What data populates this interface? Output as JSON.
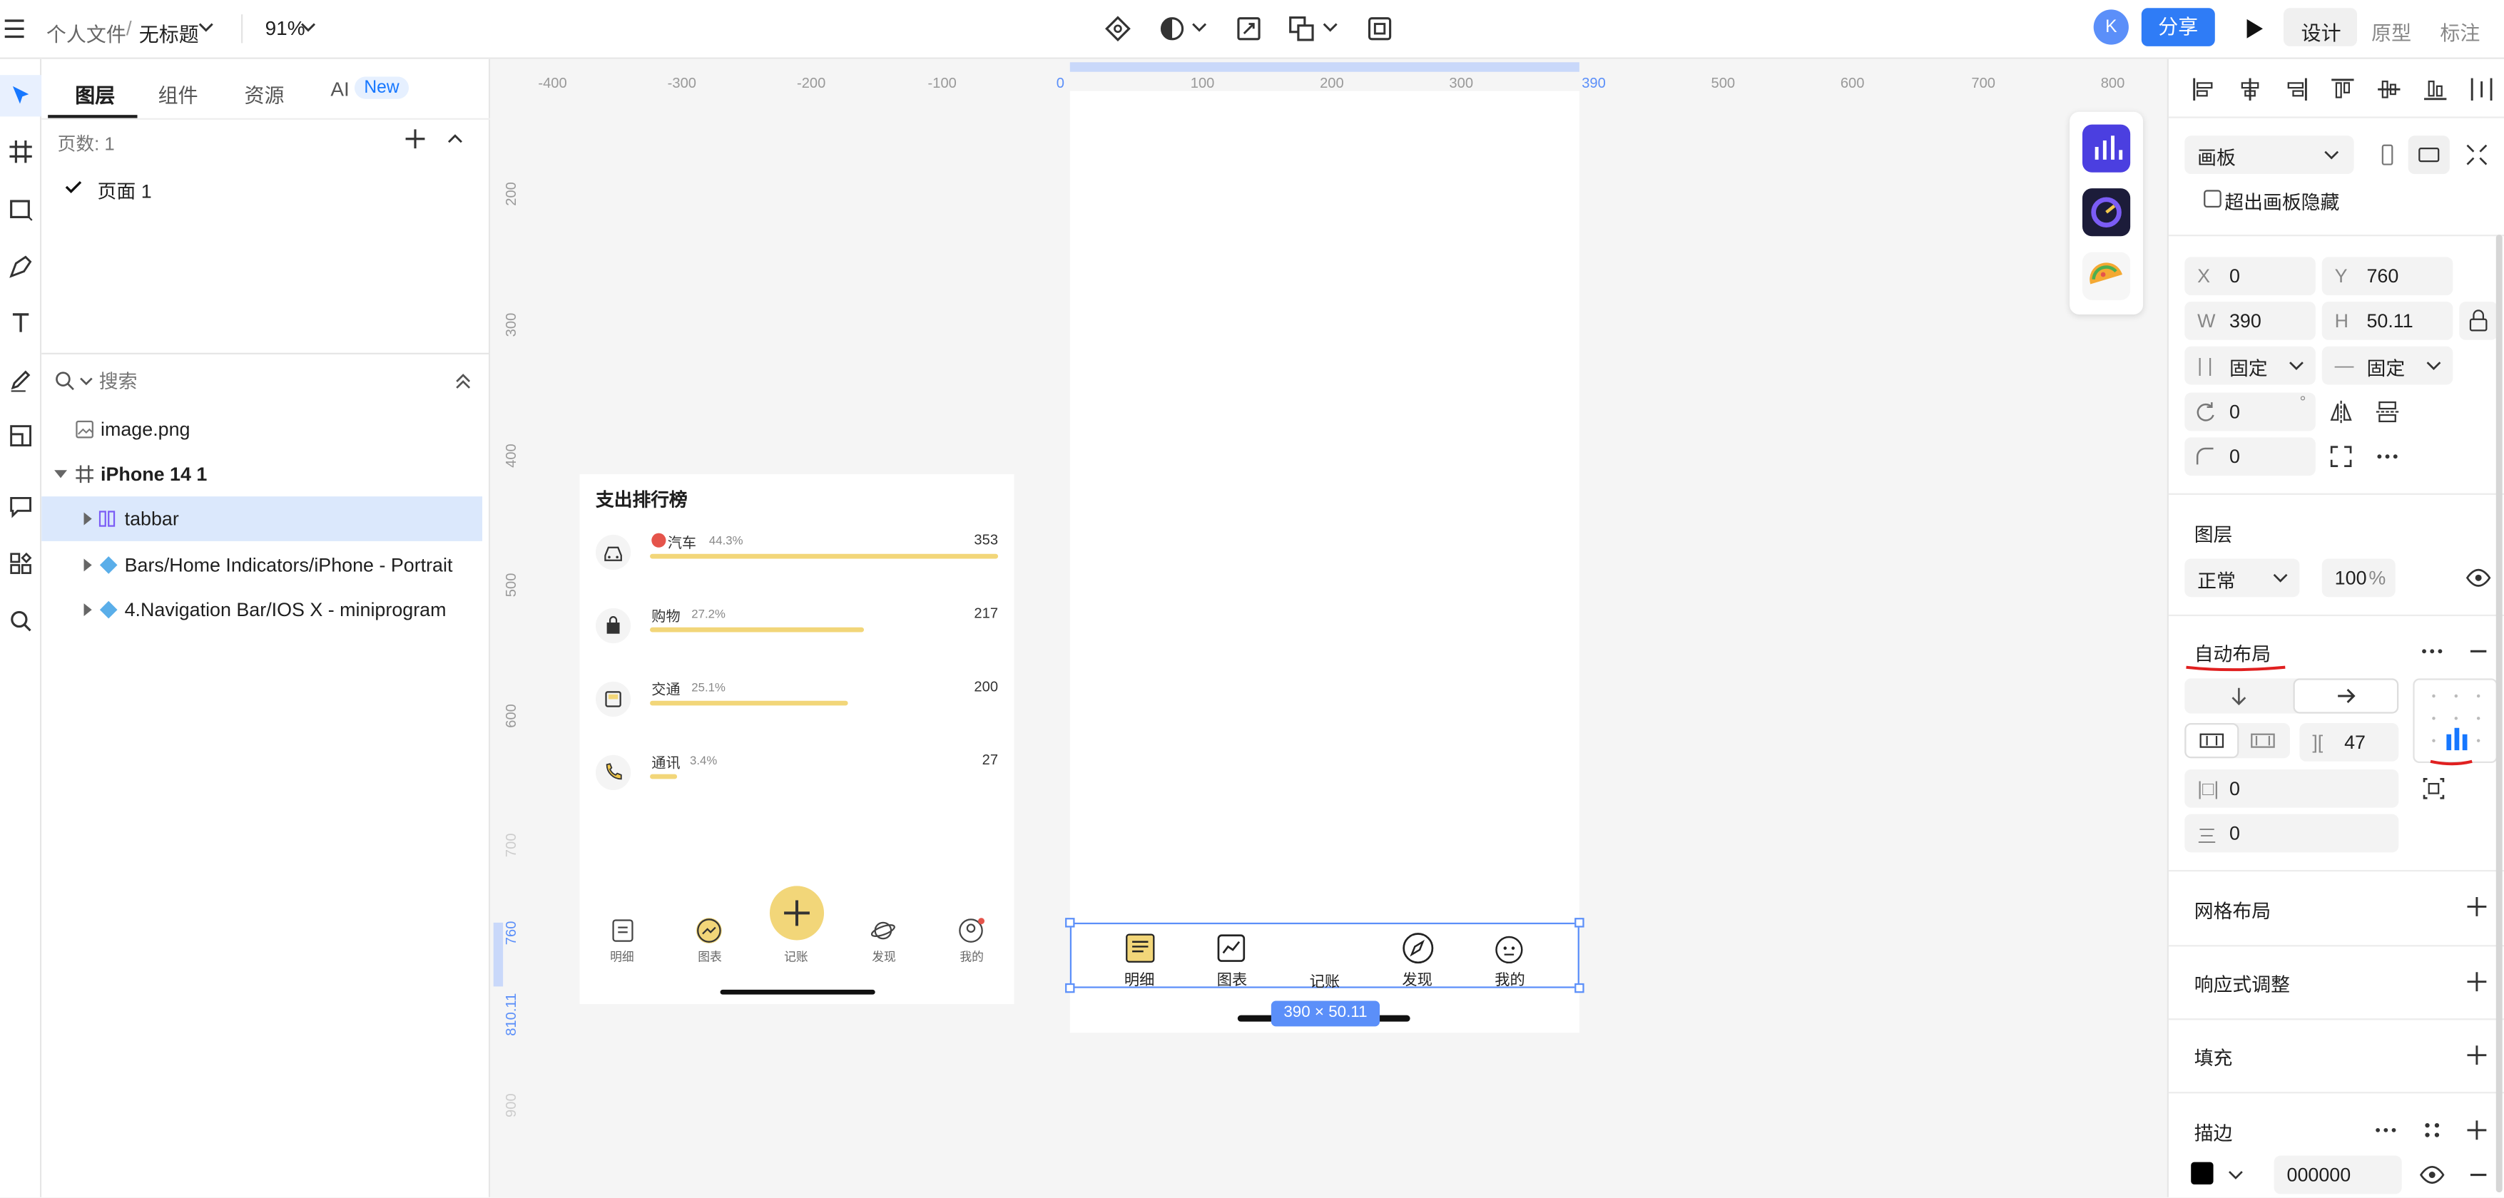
{
  "topbar": {
    "breadcrumb_parent": "个人文件",
    "breadcrumb_sep": "/",
    "file_name": "无标题",
    "zoom": "91%",
    "avatar_letter": "K",
    "share_label": "分享",
    "mode_tabs": [
      "设计",
      "原型",
      "标注"
    ]
  },
  "layers_panel": {
    "tabs": [
      "图层",
      "组件",
      "资源",
      "AI"
    ],
    "ai_badge": "New",
    "page_count_label": "页数: 1",
    "pages": [
      "页面 1"
    ],
    "search_placeholder": "搜索",
    "layers": [
      {
        "name": "image.png",
        "depth": 0
      },
      {
        "name": "iPhone 14 1",
        "depth": 0
      },
      {
        "name": "tabbar",
        "depth": 1
      },
      {
        "name": "Bars/Home Indicators/iPhone - Portrait",
        "depth": 1
      },
      {
        "name": "4.Navigation Bar/IOS X - miniprogram",
        "depth": 1
      }
    ]
  },
  "canvas": {
    "ruler_x": [
      "-400",
      "-300",
      "-200",
      "-100",
      "0",
      "100",
      "200",
      "300",
      "390",
      "500",
      "600",
      "700",
      "800"
    ],
    "ruler_y": [
      "200",
      "300",
      "400",
      "500",
      "600",
      "700",
      "760",
      "810.11",
      "900"
    ],
    "preview": {
      "title": "支出排行榜",
      "items": [
        {
          "name": "汽车",
          "pct": "44.3%",
          "amount": "353",
          "fill": 1.0
        },
        {
          "name": "购物",
          "pct": "27.2%",
          "amount": "217",
          "fill": 0.615
        },
        {
          "name": "交通",
          "pct": "25.1%",
          "amount": "200",
          "fill": 0.567
        },
        {
          "name": "通讯",
          "pct": "3.4%",
          "amount": "27",
          "fill": 0.077
        }
      ],
      "tabs": [
        "明细",
        "图表",
        "记账",
        "发现",
        "我的"
      ]
    },
    "frame_tabs": [
      "明细",
      "图表",
      "记账",
      "发现",
      "我的"
    ],
    "size_label": "390 × 50.11"
  },
  "design_panel": {
    "frame_type": "画板",
    "clip_label": "超出画板隐藏",
    "x": "0",
    "y": "760",
    "w": "390",
    "h": "50.11",
    "width_mode": "固定",
    "height_mode": "固定",
    "rotation": "0",
    "rotation_unit": "°",
    "radius": "0",
    "layer_section": "图层",
    "blend_mode": "正常",
    "opacity": "100",
    "opacity_unit": "%",
    "auto_layout": "自动布局",
    "gap": "47",
    "padding_h": "0",
    "padding_v": "0",
    "grid_layout": "网格布局",
    "responsive": "响应式调整",
    "fill": "填充",
    "stroke": "描边",
    "stroke_color": "000000"
  },
  "colors": {
    "accent": "#1677ff",
    "share": "#2f7cf6",
    "selection": "#dbe8fc",
    "yellow": "#f2d679",
    "frame_border": "#5b8ff9",
    "annotation_red": "#e02020"
  }
}
